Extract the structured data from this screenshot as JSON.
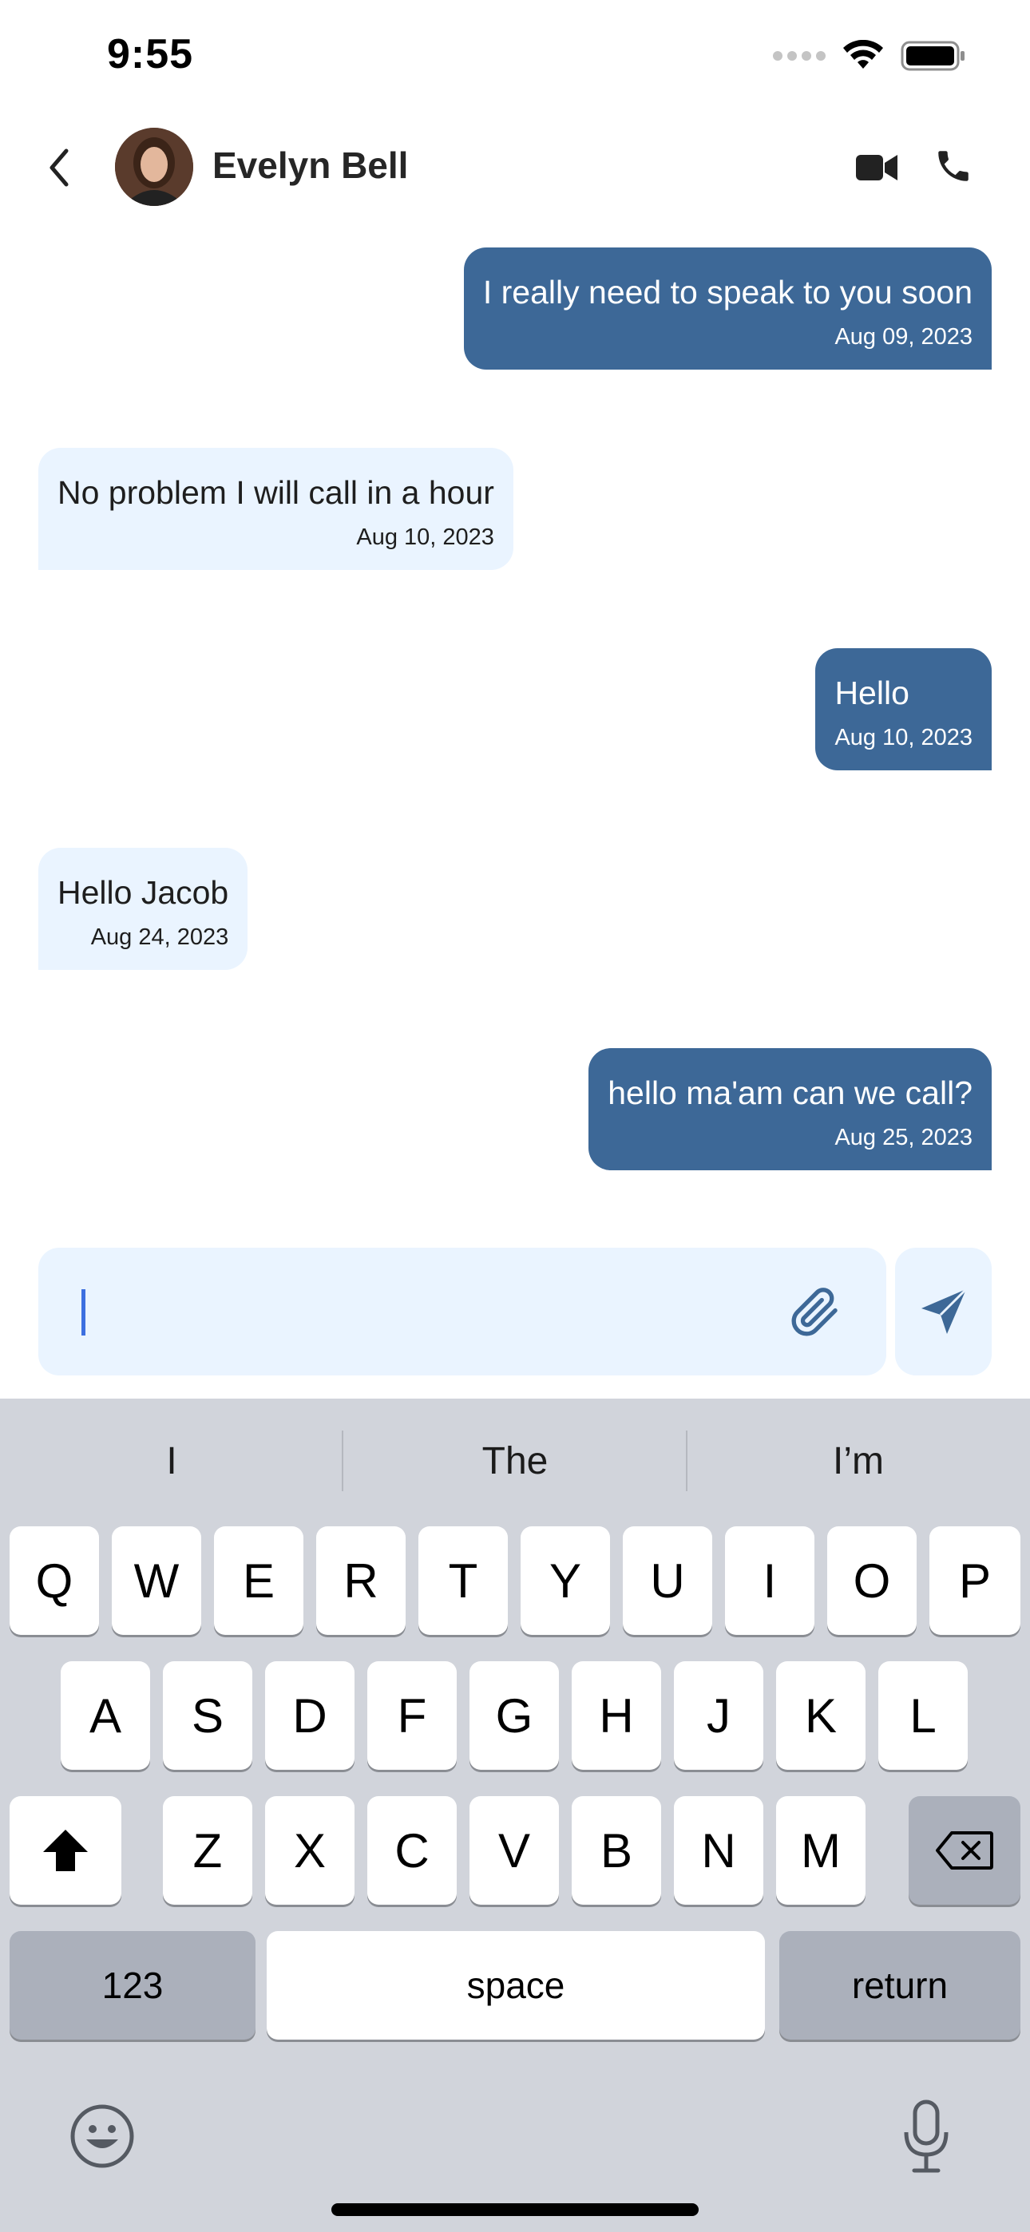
{
  "status_bar": {
    "time": "9:55"
  },
  "header": {
    "contact_name": "Evelyn Bell",
    "icons": {
      "back": "chevron-left-icon",
      "video": "video-camera-icon",
      "phone": "phone-icon"
    }
  },
  "messages": [
    {
      "direction": "outgoing",
      "text": "I really need to speak to you soon",
      "date": "Aug 09, 2023"
    },
    {
      "direction": "incoming",
      "text": "No problem I will call in a hour",
      "date": "Aug 10, 2023"
    },
    {
      "direction": "outgoing",
      "text": "Hello",
      "date": "Aug 10, 2023"
    },
    {
      "direction": "incoming",
      "text": "Hello Jacob",
      "date": "Aug 24, 2023"
    },
    {
      "direction": "outgoing",
      "text": "hello ma'am can we call?",
      "date": "Aug 25, 2023"
    }
  ],
  "composer": {
    "value": "",
    "icons": {
      "attach": "paperclip-icon",
      "send": "send-icon"
    }
  },
  "keyboard": {
    "suggestions": [
      "I",
      "The",
      "I’m"
    ],
    "row1": [
      "Q",
      "W",
      "E",
      "R",
      "T",
      "Y",
      "U",
      "I",
      "O",
      "P"
    ],
    "row2": [
      "A",
      "S",
      "D",
      "F",
      "G",
      "H",
      "J",
      "K",
      "L"
    ],
    "row3": [
      "Z",
      "X",
      "C",
      "V",
      "B",
      "N",
      "M"
    ],
    "numbers_label": "123",
    "space_label": "space",
    "return_label": "return"
  },
  "colors": {
    "outgoing_bubble": "#3d6897",
    "incoming_bubble": "#eaf4ff",
    "accent": "#3d6897",
    "keyboard_bg": "#d1d4db"
  }
}
